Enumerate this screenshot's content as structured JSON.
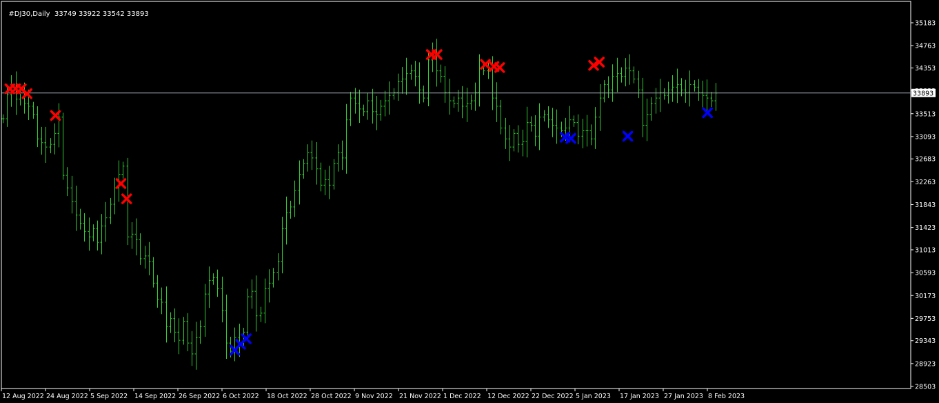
{
  "header": {
    "symbol": "#DJ30,Daily",
    "ohlc": "33749 33922 33542 33893"
  },
  "colors": {
    "background": "#000000",
    "frame": "#ffffff",
    "bar": "#32cd32",
    "current_price_line": "#a9b0bd",
    "sell_marker": "#ff0000",
    "buy_marker": "#0000ff",
    "text": "#ffffff"
  },
  "chart_data": {
    "type": "ohlc",
    "current_price": 33893,
    "current_price_label": "33893",
    "ylim": [
      28403,
      35363
    ],
    "y_ticks": [
      {
        "value": 35183,
        "label": "35183"
      },
      {
        "value": 34763,
        "label": "34763"
      },
      {
        "value": 34353,
        "label": "34353"
      },
      {
        "value": 33933,
        "label": "33933"
      },
      {
        "value": 33513,
        "label": "33513"
      },
      {
        "value": 33093,
        "label": "33093"
      },
      {
        "value": 32683,
        "label": "32683"
      },
      {
        "value": 32263,
        "label": "32263"
      },
      {
        "value": 31843,
        "label": "31843"
      },
      {
        "value": 31423,
        "label": "31423"
      },
      {
        "value": 31013,
        "label": "31013"
      },
      {
        "value": 30593,
        "label": "30593"
      },
      {
        "value": 30173,
        "label": "30173"
      },
      {
        "value": 29753,
        "label": "29753"
      },
      {
        "value": 29343,
        "label": "29343"
      },
      {
        "value": 28923,
        "label": "28923"
      },
      {
        "value": 28503,
        "label": "28503"
      }
    ],
    "x_ticks": [
      {
        "index": 0,
        "label": "12 Aug 2022"
      },
      {
        "index": 8,
        "label": "24 Aug 2022"
      },
      {
        "index": 16,
        "label": "5 Sep 2022"
      },
      {
        "index": 24,
        "label": "14 Sep 2022"
      },
      {
        "index": 32,
        "label": "26 Sep 2022"
      },
      {
        "index": 40,
        "label": "6 Oct 2022"
      },
      {
        "index": 48,
        "label": "18 Oct 2022"
      },
      {
        "index": 56,
        "label": "28 Oct 2022"
      },
      {
        "index": 64,
        "label": "9 Nov 2022"
      },
      {
        "index": 72,
        "label": "21 Nov 2022"
      },
      {
        "index": 80,
        "label": "1 Dec 2022"
      },
      {
        "index": 88,
        "label": "12 Dec 2022"
      },
      {
        "index": 96,
        "label": "22 Dec 2022"
      },
      {
        "index": 104,
        "label": "5 Jan 2023"
      },
      {
        "index": 112,
        "label": "17 Jan 2023"
      },
      {
        "index": 120,
        "label": "27 Jan 2023"
      },
      {
        "index": 128,
        "label": "8 Feb 2023"
      }
    ],
    "closes": [
      33420,
      33860,
      34000,
      33780,
      33900,
      33700,
      33650,
      33500,
      33050,
      32980,
      32900,
      32950,
      33150,
      33450,
      32380,
      32150,
      31900,
      31650,
      31500,
      31350,
      31250,
      31400,
      31150,
      31450,
      31600,
      31850,
      32150,
      32400,
      32550,
      31250,
      31300,
      31200,
      30850,
      30900,
      30800,
      30400,
      30100,
      30050,
      29600,
      29750,
      29500,
      29350,
      29700,
      29300,
      29100,
      29400,
      29600,
      30200,
      30450,
      30500,
      30300,
      29900,
      29300,
      29150,
      29400,
      29300,
      29500,
      30150,
      30250,
      29800,
      29850,
      30300,
      30400,
      30600,
      30800,
      31400,
      31700,
      31800,
      32100,
      32400,
      32600,
      32800,
      32700,
      32500,
      32200,
      32300,
      32200,
      32600,
      32800,
      32700,
      33400,
      33800,
      33700,
      33600,
      33550,
      33750,
      33550,
      33500,
      33650,
      33750,
      33850,
      33900,
      34100,
      34150,
      34250,
      34300,
      34200,
      33950,
      33800,
      34500,
      34600,
      34300,
      34200,
      33900,
      33750,
      33700,
      33800,
      33650,
      33700,
      33750,
      33900,
      34350,
      34300,
      34350,
      33800,
      33650,
      33250,
      33050,
      32900,
      33150,
      32950,
      33000,
      33350,
      33300,
      33100,
      33450,
      33500,
      33400,
      33300,
      33250,
      33200,
      33250,
      33400,
      33350,
      33100,
      33200,
      33200,
      33050,
      33450,
      33800,
      34050,
      33950,
      34200,
      34250,
      34200,
      34350,
      34300,
      34150,
      33950,
      33300,
      33500,
      33700,
      33800,
      33900,
      33850,
      33950,
      34000,
      34050,
      33950,
      33900,
      34050,
      34000,
      33900,
      33850,
      33800,
      33750,
      33893
    ],
    "sell_markers": [
      {
        "index": 3,
        "price": 33970
      },
      {
        "index": 5,
        "price": 33970
      },
      {
        "index": 7,
        "price": 33970
      },
      {
        "index": 9,
        "price": 33880
      },
      {
        "index": 19,
        "price": 33480
      },
      {
        "index": 42,
        "price": 32230
      },
      {
        "index": 44,
        "price": 31950
      },
      {
        "index": 151,
        "price": 34600
      },
      {
        "index": 153,
        "price": 34600
      },
      {
        "index": 170,
        "price": 34420
      },
      {
        "index": 173,
        "price": 34380
      },
      {
        "index": 175,
        "price": 34360
      },
      {
        "index": 208,
        "price": 34400
      },
      {
        "index": 210,
        "price": 34460
      }
    ],
    "buy_markers": [
      {
        "index": 82,
        "price": 29170
      },
      {
        "index": 84,
        "price": 29280
      },
      {
        "index": 86,
        "price": 29380
      },
      {
        "index": 198,
        "price": 33080
      },
      {
        "index": 200,
        "price": 33060
      },
      {
        "index": 220,
        "price": 33100
      },
      {
        "index": 248,
        "price": 33530
      }
    ]
  }
}
